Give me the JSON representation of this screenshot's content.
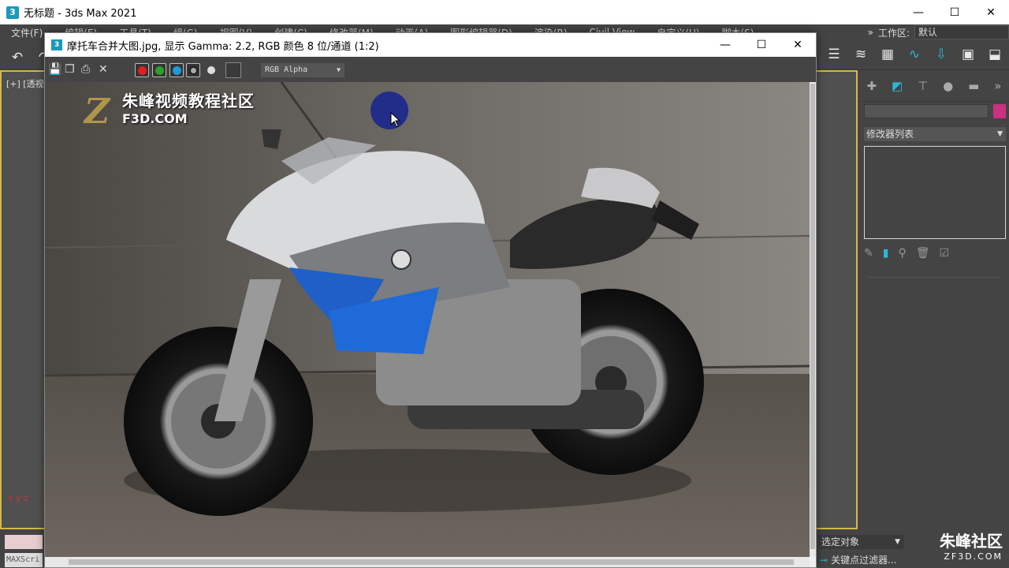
{
  "app": {
    "title": "无标题 - 3ds Max 2021",
    "icon_label": "3"
  },
  "window_controls": {
    "minimize": "—",
    "maximize": "☐",
    "close": "✕"
  },
  "menu": [
    "文件(F)",
    "编辑(E)",
    "工具(T)",
    "组(G)",
    "视图(V)",
    "创建(C)",
    "修改器(M)",
    "动画(A)",
    "图形编辑器(D)",
    "渲染(R)",
    "Civil View",
    "自定义(U)",
    "脚本(S)"
  ],
  "workspace": {
    "expand_glyph": "»",
    "label": "工作区:",
    "value": "默认"
  },
  "viewport": {
    "label": "[+] [透视",
    "axis": "x y z"
  },
  "frame_buffer": {
    "title": "摩托车合并大图.jpg, 显示 Gamma: 2.2, RGB 颜色 8 位/通道 (1:2)",
    "channel_select": "RGB Alpha",
    "watermark_title": "朱峰视频教程社区",
    "watermark_sub": "F3D.COM",
    "watermark_logo": "Z",
    "channel_colors": [
      "#e02020",
      "#2ca02c",
      "#1f9bd6"
    ]
  },
  "command_panel": {
    "modifier_list": "修改器列表",
    "accent": "#2bb7d6",
    "object_color": "#c83280"
  },
  "statusbar": {
    "maxscript": "MAXScri",
    "selection": "选定对象",
    "key_filter": "关键点过滤器..."
  },
  "corner_watermark": {
    "title": "朱峰社区",
    "sub": "ZF3D.COM"
  }
}
